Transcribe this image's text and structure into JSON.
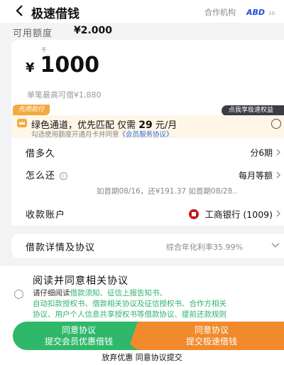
{
  "header": {
    "back_icon": "chevron-left-icon",
    "title": "极速借钱",
    "partner_label": "合作机构",
    "partner_logo_text": "ABD",
    "partner_logo_sub": "10"
  },
  "available": {
    "label": "可用额度",
    "value": "¥2.000"
  },
  "loan": {
    "unit": "千",
    "currency": "¥",
    "amount": "1000",
    "max_text": "单笔最高可借¥1,880"
  },
  "promo": {
    "tag": "先用后付",
    "vip_tag": "点我享极速权益",
    "crown_icon": "crown-icon",
    "text_before": "绿色通道，优先匹配 仅需 ",
    "price": "29",
    "text_after": " 元/月",
    "sub_before": "勾选使用额度开通月卡并同意",
    "sub_link": "《会员服务协议》"
  },
  "rows": {
    "term_label": "借多久",
    "term_value": "分6期",
    "repay_label": "怎么还",
    "repay_value": "每月等额",
    "repay_sub": "如首期08/16，还¥191.37  如首期08/28..",
    "account_label": "收款账户",
    "account_value": "工商银行 (1009)"
  },
  "details": {
    "label": "借款详情及协议",
    "rate": "综合年化利率35.99%"
  },
  "agreement": {
    "title": "阅读并同意相关协议",
    "line1_prefix": "请仔细阅读",
    "line1_links": "借款须知、征信上报告知书、",
    "line2": "自动扣款授权书、借款相关协议及征信授权书、合作方相关",
    "line3": "协议、用户个人信息共享授权书等借款协议、提前还款规则"
  },
  "buttons": {
    "green_line1": "同意协议",
    "green_line2": "提交会员优惠借钱",
    "orange_line1": "同意协议",
    "orange_line2": "提交极速借钱",
    "give_up": "放弃优惠 同意协议提交"
  },
  "colors": {
    "green": "#2fb86a",
    "orange": "#f08a2c",
    "promo_tag": "#f4a940",
    "link_blue": "#2f6fe0"
  }
}
